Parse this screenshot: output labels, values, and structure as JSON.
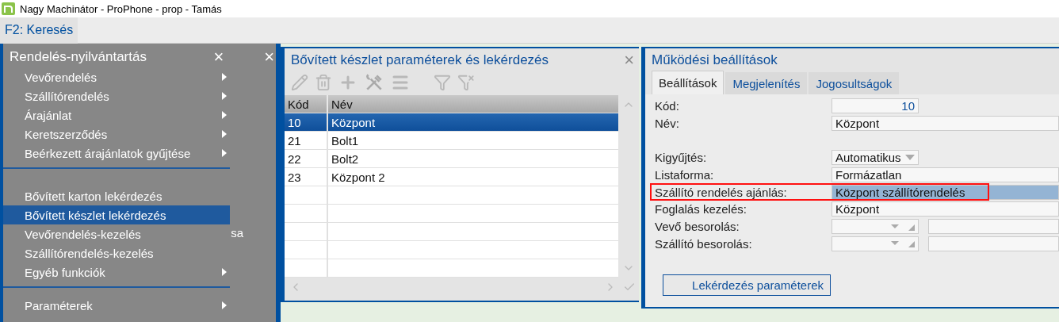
{
  "window": {
    "title": "Nagy Machinátor - ProPhone - prop - Tamás"
  },
  "toolbar": {
    "search_button": "F2: Keresés"
  },
  "menu": {
    "title": "Rendelés-nyilvántartás",
    "close": "×",
    "sections": [
      [
        {
          "label": "Vevőrendelés",
          "submenu": true,
          "selected": false
        },
        {
          "label": "Szállítórendelés",
          "submenu": true,
          "selected": false
        },
        {
          "label": "Árajánlat",
          "submenu": true,
          "selected": false
        },
        {
          "label": "Keretszerződés",
          "submenu": true,
          "selected": false
        },
        {
          "label": "Beérkezett árajánlatok gyűjtése",
          "submenu": true,
          "selected": false
        }
      ],
      [
        {
          "label": "Bővített karton lekérdezés",
          "submenu": false,
          "selected": false
        },
        {
          "label": "Bővített készlet lekérdezés",
          "submenu": false,
          "selected": true
        },
        {
          "label": "Vevőrendelés-kezelés",
          "submenu": false,
          "selected": false
        },
        {
          "label": "Szállítórendelés-kezelés",
          "submenu": false,
          "selected": false
        },
        {
          "label": "Egyéb funkciók",
          "submenu": true,
          "selected": false
        }
      ],
      [
        {
          "label": "Paraméterek",
          "submenu": true,
          "selected": false
        }
      ]
    ]
  },
  "back_panel": {
    "close": "×",
    "text": "sa"
  },
  "stock_panel": {
    "title": "Bővített készlet paraméterek és lekérdezés",
    "close": "×",
    "columns": [
      "Kód",
      "Név"
    ],
    "rows": [
      {
        "code": "10",
        "name": "Központ",
        "selected": true
      },
      {
        "code": "21",
        "name": "Bolt1",
        "selected": false
      },
      {
        "code": "22",
        "name": "Bolt2",
        "selected": false
      },
      {
        "code": "23",
        "name": "Központ 2",
        "selected": false
      }
    ]
  },
  "settings_panel": {
    "title": "Működési beállítások",
    "tabs": [
      {
        "label": "Beállítások",
        "selected": true
      },
      {
        "label": "Megjelenítés",
        "selected": false
      },
      {
        "label": "Jogosultságok",
        "selected": false
      }
    ],
    "fields": [
      {
        "kind": "number",
        "label": "Kód:",
        "value": "10",
        "highlighted": false
      },
      {
        "kind": "text",
        "label": "Név:",
        "value": "Központ",
        "highlighted": false
      },
      {
        "kind": "blank"
      },
      {
        "kind": "select",
        "label": "Kigyűjtés:",
        "value": "Automatikus",
        "highlighted": false
      },
      {
        "kind": "text",
        "label": "Listaforma:",
        "value": "Formázatlan",
        "highlighted": false
      },
      {
        "kind": "text",
        "label": "Szállító rendelés ajánlás:",
        "value": "Központ szállítórendelés",
        "highlighted": true
      },
      {
        "kind": "text",
        "label": "Foglalás kezelés:",
        "value": "Központ",
        "highlighted": false
      },
      {
        "kind": "classification",
        "label": "Vevő besorolás:",
        "highlighted": false
      },
      {
        "kind": "classification",
        "label": "Szállító besorolás:",
        "highlighted": false
      }
    ],
    "button": "Lekérdezés paraméterek"
  }
}
